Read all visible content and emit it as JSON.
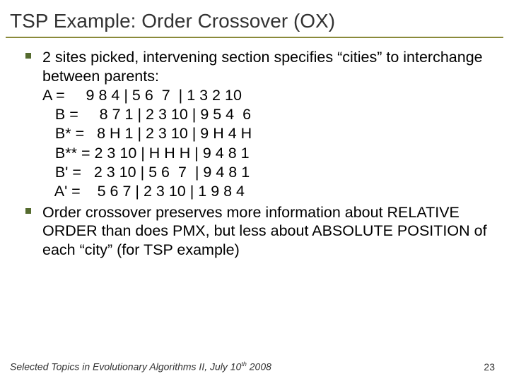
{
  "title": "TSP Example: Order Crossover (OX)",
  "bullets": [
    {
      "text": "2 sites picked, intervening section specifies “cities” to interchange between parents:",
      "eq": [
        "A =     9 8 4 | 5 6  7  | 1 3 2 10",
        "   B =     8 7 1 | 2 3 10 | 9 5 4  6",
        "   B* =   8 H 1 | 2 3 10 | 9 H 4 H",
        "   B** = 2 3 10 | H H H | 9 4 8 1",
        "   B' =   2 3 10 | 5 6  7  | 9 4 8 1",
        "   A' =    5 6 7 | 2 3 10 | 1 9 8 4"
      ]
    },
    {
      "text": "Order crossover preserves more information about RELATIVE ORDER than does PMX, but less about ABSOLUTE POSITION of each “city” (for TSP example)",
      "eq": []
    }
  ],
  "footer_prefix": "Selected Topics in Evolutionary Algorithms II, July 10",
  "footer_suffix": " 2008",
  "footer_sup": "th",
  "page_number": "23"
}
